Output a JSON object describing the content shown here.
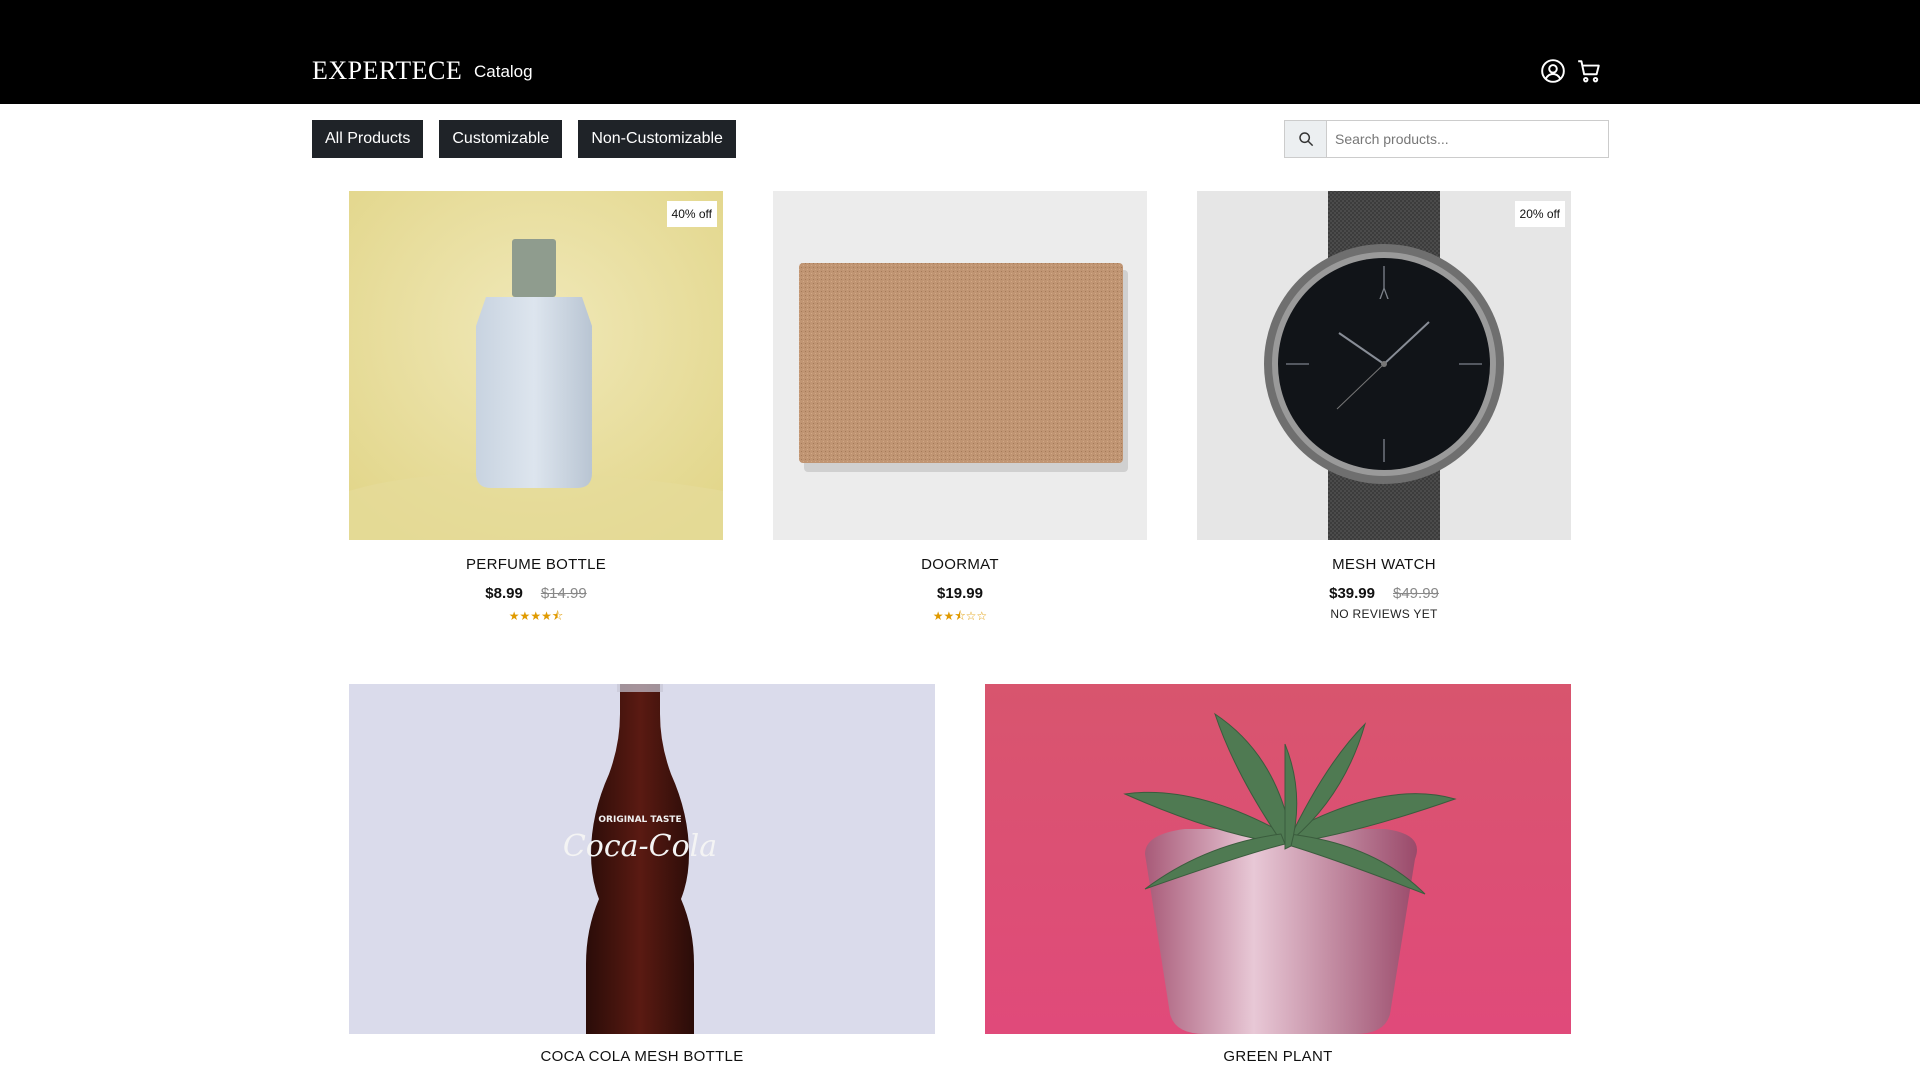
{
  "header": {
    "logo": "EXPERTECE",
    "nav": {
      "catalog": "Catalog"
    },
    "icons": [
      "user-icon",
      "cart-icon"
    ]
  },
  "filters": {
    "all": "All Products",
    "customizable": "Customizable",
    "non_customizable": "Non-Customizable"
  },
  "search": {
    "placeholder": "Search products..."
  },
  "products": [
    {
      "name": "PERFUME BOTTLE",
      "price": "$8.99",
      "old_price": "$14.99",
      "badge": "40% off",
      "rating": 4.5,
      "rating_stars": "★★★★⯪",
      "reviews": ""
    },
    {
      "name": "DOORMAT",
      "price": "$19.99",
      "old_price": "",
      "badge": "",
      "rating": 2.5,
      "rating_stars": "★★⯪☆☆",
      "reviews": ""
    },
    {
      "name": "MESH WATCH",
      "price": "$39.99",
      "old_price": "$49.99",
      "badge": "20% off",
      "rating": null,
      "rating_stars": "",
      "reviews": "NO REVIEWS YET"
    },
    {
      "name": "COCA COLA MESH BOTTLE"
    },
    {
      "name": "GREEN PLANT"
    }
  ],
  "colors": {
    "header_bg": "#000000",
    "button_bg": "#1f2328",
    "star": "#e09a00"
  }
}
